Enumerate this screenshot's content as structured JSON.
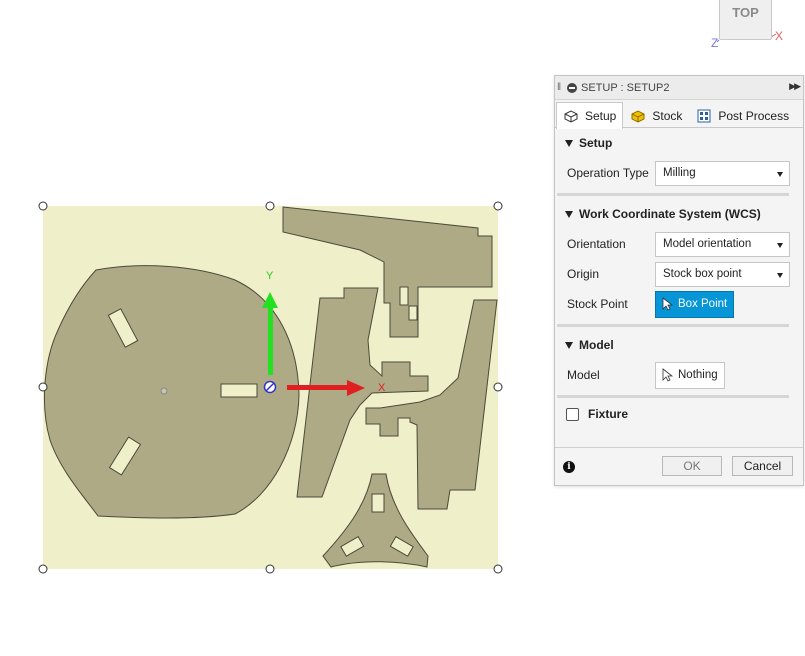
{
  "viewcube": {
    "face_label": "TOP",
    "axis_x": "X",
    "axis_z": "Z"
  },
  "canvas": {
    "axis_y_label": "Y",
    "axis_x_label": "X",
    "origin_label": "Z"
  },
  "panel": {
    "title": "SETUP : SETUP2",
    "tabs": [
      {
        "label": "Setup",
        "icon": "setup-icon",
        "active": true
      },
      {
        "label": "Stock",
        "icon": "stock-icon",
        "active": false
      },
      {
        "label": "Post Process",
        "icon": "post-process-icon",
        "active": false
      }
    ],
    "setup": {
      "heading": "Setup",
      "operation_type_label": "Operation Type",
      "operation_type_value": "Milling"
    },
    "wcs": {
      "heading": "Work Coordinate System (WCS)",
      "orientation_label": "Orientation",
      "orientation_value": "Model orientation",
      "origin_label": "Origin",
      "origin_value": "Stock box point",
      "stock_point_label": "Stock Point",
      "stock_point_button": "Box Point"
    },
    "model": {
      "heading": "Model",
      "model_label": "Model",
      "model_button": "Nothing"
    },
    "fixture": {
      "label": "Fixture"
    },
    "footer": {
      "ok": "OK",
      "cancel": "Cancel"
    }
  },
  "colors": {
    "stock_fill": "#efefc9",
    "part_fill": "#aeaa85",
    "part_stroke": "#4a4a3a",
    "accent_blue": "#0696d7"
  }
}
